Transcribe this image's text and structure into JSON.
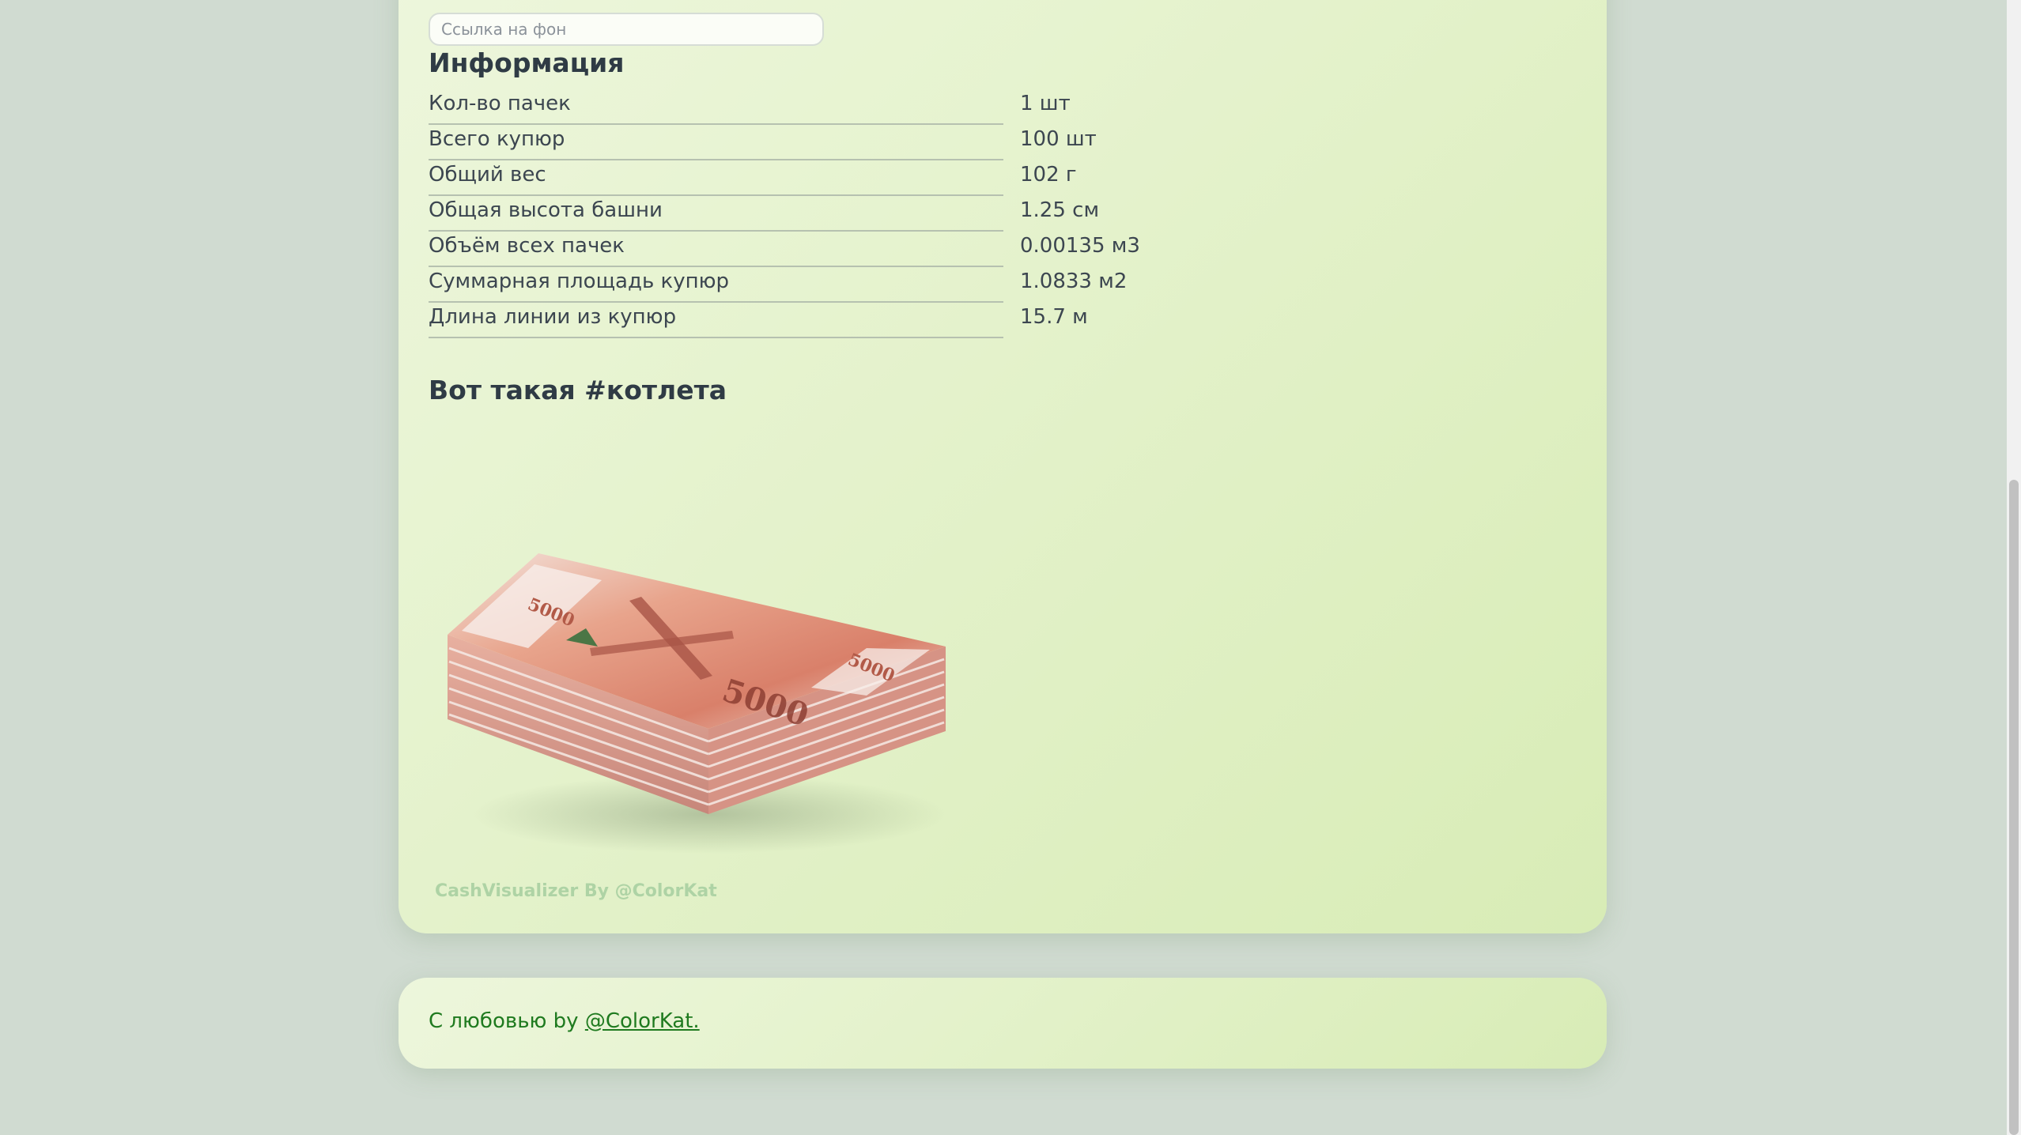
{
  "background_input": {
    "placeholder": "Ссылка на фон",
    "value": ""
  },
  "info": {
    "title": "Информация",
    "rows": [
      {
        "label": "Кол-во пачек",
        "value": "1 шт"
      },
      {
        "label": "Всего купюр",
        "value": "100 шт"
      },
      {
        "label": "Общий вес",
        "value": "102 г"
      },
      {
        "label": "Общая высота башни",
        "value": "1.25 см"
      },
      {
        "label": "Объём всех пачек",
        "value": "0.00135 м3"
      },
      {
        "label": "Суммарная площадь купюр",
        "value": "1.0833 м2"
      },
      {
        "label": "Длина линии из купюр",
        "value": "15.7 м"
      }
    ]
  },
  "cutlet": {
    "title": "Вот такая #котлета",
    "watermark": "CashVisualizer By @ColorKat"
  },
  "footer": {
    "text": "С любовью by ",
    "link": "@ColorKat."
  },
  "colors": {
    "page_bg": "#d0dbd1",
    "card_gradient_start": "#edf6dc",
    "card_gradient_end": "#d8ecb6",
    "footer_text": "#1f7a1f",
    "watermark": "#aed3a5"
  }
}
